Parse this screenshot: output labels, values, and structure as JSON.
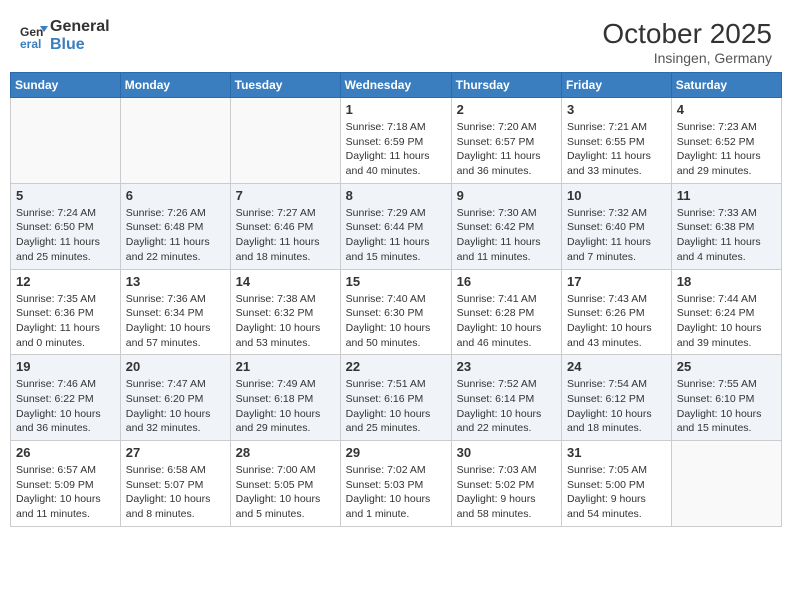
{
  "header": {
    "logo_line1": "General",
    "logo_line2": "Blue",
    "month": "October 2025",
    "location": "Insingen, Germany"
  },
  "weekdays": [
    "Sunday",
    "Monday",
    "Tuesday",
    "Wednesday",
    "Thursday",
    "Friday",
    "Saturday"
  ],
  "weeks": [
    [
      {
        "day": "",
        "info": ""
      },
      {
        "day": "",
        "info": ""
      },
      {
        "day": "",
        "info": ""
      },
      {
        "day": "1",
        "info": "Sunrise: 7:18 AM\nSunset: 6:59 PM\nDaylight: 11 hours\nand 40 minutes."
      },
      {
        "day": "2",
        "info": "Sunrise: 7:20 AM\nSunset: 6:57 PM\nDaylight: 11 hours\nand 36 minutes."
      },
      {
        "day": "3",
        "info": "Sunrise: 7:21 AM\nSunset: 6:55 PM\nDaylight: 11 hours\nand 33 minutes."
      },
      {
        "day": "4",
        "info": "Sunrise: 7:23 AM\nSunset: 6:52 PM\nDaylight: 11 hours\nand 29 minutes."
      }
    ],
    [
      {
        "day": "5",
        "info": "Sunrise: 7:24 AM\nSunset: 6:50 PM\nDaylight: 11 hours\nand 25 minutes."
      },
      {
        "day": "6",
        "info": "Sunrise: 7:26 AM\nSunset: 6:48 PM\nDaylight: 11 hours\nand 22 minutes."
      },
      {
        "day": "7",
        "info": "Sunrise: 7:27 AM\nSunset: 6:46 PM\nDaylight: 11 hours\nand 18 minutes."
      },
      {
        "day": "8",
        "info": "Sunrise: 7:29 AM\nSunset: 6:44 PM\nDaylight: 11 hours\nand 15 minutes."
      },
      {
        "day": "9",
        "info": "Sunrise: 7:30 AM\nSunset: 6:42 PM\nDaylight: 11 hours\nand 11 minutes."
      },
      {
        "day": "10",
        "info": "Sunrise: 7:32 AM\nSunset: 6:40 PM\nDaylight: 11 hours\nand 7 minutes."
      },
      {
        "day": "11",
        "info": "Sunrise: 7:33 AM\nSunset: 6:38 PM\nDaylight: 11 hours\nand 4 minutes."
      }
    ],
    [
      {
        "day": "12",
        "info": "Sunrise: 7:35 AM\nSunset: 6:36 PM\nDaylight: 11 hours\nand 0 minutes."
      },
      {
        "day": "13",
        "info": "Sunrise: 7:36 AM\nSunset: 6:34 PM\nDaylight: 10 hours\nand 57 minutes."
      },
      {
        "day": "14",
        "info": "Sunrise: 7:38 AM\nSunset: 6:32 PM\nDaylight: 10 hours\nand 53 minutes."
      },
      {
        "day": "15",
        "info": "Sunrise: 7:40 AM\nSunset: 6:30 PM\nDaylight: 10 hours\nand 50 minutes."
      },
      {
        "day": "16",
        "info": "Sunrise: 7:41 AM\nSunset: 6:28 PM\nDaylight: 10 hours\nand 46 minutes."
      },
      {
        "day": "17",
        "info": "Sunrise: 7:43 AM\nSunset: 6:26 PM\nDaylight: 10 hours\nand 43 minutes."
      },
      {
        "day": "18",
        "info": "Sunrise: 7:44 AM\nSunset: 6:24 PM\nDaylight: 10 hours\nand 39 minutes."
      }
    ],
    [
      {
        "day": "19",
        "info": "Sunrise: 7:46 AM\nSunset: 6:22 PM\nDaylight: 10 hours\nand 36 minutes."
      },
      {
        "day": "20",
        "info": "Sunrise: 7:47 AM\nSunset: 6:20 PM\nDaylight: 10 hours\nand 32 minutes."
      },
      {
        "day": "21",
        "info": "Sunrise: 7:49 AM\nSunset: 6:18 PM\nDaylight: 10 hours\nand 29 minutes."
      },
      {
        "day": "22",
        "info": "Sunrise: 7:51 AM\nSunset: 6:16 PM\nDaylight: 10 hours\nand 25 minutes."
      },
      {
        "day": "23",
        "info": "Sunrise: 7:52 AM\nSunset: 6:14 PM\nDaylight: 10 hours\nand 22 minutes."
      },
      {
        "day": "24",
        "info": "Sunrise: 7:54 AM\nSunset: 6:12 PM\nDaylight: 10 hours\nand 18 minutes."
      },
      {
        "day": "25",
        "info": "Sunrise: 7:55 AM\nSunset: 6:10 PM\nDaylight: 10 hours\nand 15 minutes."
      }
    ],
    [
      {
        "day": "26",
        "info": "Sunrise: 6:57 AM\nSunset: 5:09 PM\nDaylight: 10 hours\nand 11 minutes."
      },
      {
        "day": "27",
        "info": "Sunrise: 6:58 AM\nSunset: 5:07 PM\nDaylight: 10 hours\nand 8 minutes."
      },
      {
        "day": "28",
        "info": "Sunrise: 7:00 AM\nSunset: 5:05 PM\nDaylight: 10 hours\nand 5 minutes."
      },
      {
        "day": "29",
        "info": "Sunrise: 7:02 AM\nSunset: 5:03 PM\nDaylight: 10 hours\nand 1 minute."
      },
      {
        "day": "30",
        "info": "Sunrise: 7:03 AM\nSunset: 5:02 PM\nDaylight: 9 hours\nand 58 minutes."
      },
      {
        "day": "31",
        "info": "Sunrise: 7:05 AM\nSunset: 5:00 PM\nDaylight: 9 hours\nand 54 minutes."
      },
      {
        "day": "",
        "info": ""
      }
    ]
  ]
}
